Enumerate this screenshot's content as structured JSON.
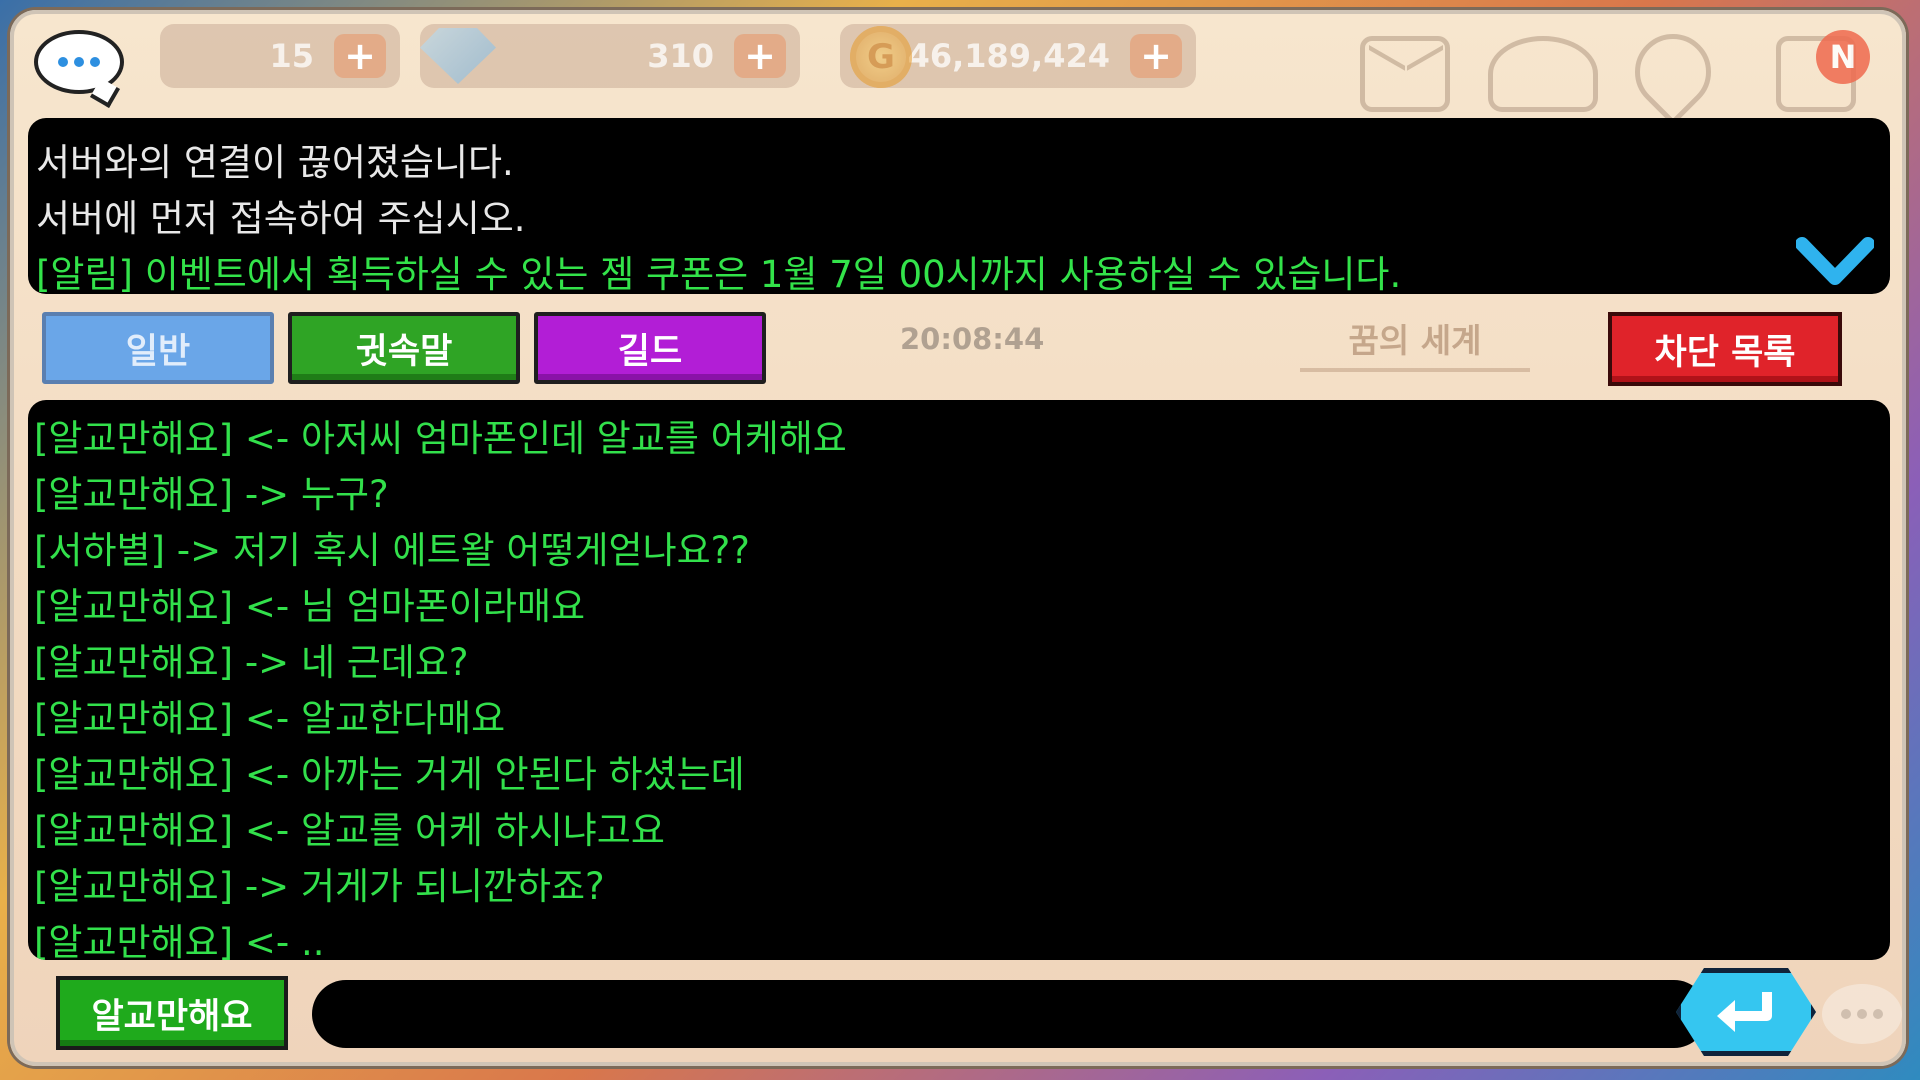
{
  "resources": {
    "energy": "15",
    "gems": "310",
    "gold": "46,189,424"
  },
  "top_icons": [
    "mail-icon",
    "cloud-icon",
    "location-pin-icon",
    "news-icon"
  ],
  "news_badge": "N",
  "system_messages": [
    "서버와의 연결이 끊어졌습니다.",
    "서버에 먼저 접속하여 주십시오."
  ],
  "notice": "[알림] 이벤트에서 획득하실 수 있는 젬 쿠폰은 1월 7일 00시까지 사용하실 수 있습니다.",
  "tabs": {
    "general": "일반",
    "whisper": "귓속말",
    "guild": "길드"
  },
  "clock": "20:08:44",
  "world_label": "꿈의 세계",
  "block_list_label": "차단 목록",
  "chat_lines": [
    "[알교만해요] <- 아저씨 엄마폰인데 알교를 어케해요",
    "[알교만해요] -> 누구?",
    "[서하별] -> 저기 혹시 에트왈 어떻게얻나요??",
    "[알교만해요] <- 님 엄마폰이라매요",
    "[알교만해요] -> 네 근데요?",
    "[알교만해요] <- 알교한다매요",
    "[알교만해요] <- 아까는 거게 안된다 하셨는데",
    "[알교만해요] <- 알교를 어케 하시냐고요",
    "[알교만해요] -> 거게가 되니깐하죠?",
    "[알교만해요] <- .."
  ],
  "input": {
    "recipient": "알교만해요",
    "value": ""
  },
  "colors": {
    "chat_text": "#32e04b",
    "system_text": "#e8e8e8",
    "whisper_tab": "#2fa425",
    "guild_tab": "#b21ed6",
    "block_button": "#e0232a",
    "send_button": "#35c6f0"
  }
}
